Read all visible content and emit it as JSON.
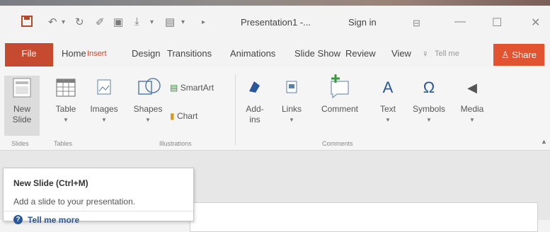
{
  "title_bar": {
    "document_title": "Presentation1 -...",
    "sign_in": "Sign in",
    "qat_icons": [
      "save-icon",
      "undo-icon",
      "redo-icon",
      "touch-mode-icon",
      "start-from-beginning-icon",
      "customize-qat-icon"
    ]
  },
  "tabs": [
    "File",
    "Home",
    "Insert",
    "Design",
    "Transitions",
    "Animations",
    "Slide Show",
    "Review",
    "View"
  ],
  "active_tab": "Insert",
  "tell_me": "Tell me",
  "share": "Share",
  "ribbon": {
    "new_slide": "New Slide",
    "table": "Table",
    "images": "Images",
    "shapes": "Shapes",
    "smartart": "SmartArt",
    "chart": "Chart",
    "addins": "Add-ins",
    "links": "Links",
    "comment": "Comment",
    "text": "Text",
    "symbols": "Symbols",
    "media": "Media",
    "groups": [
      "Slides",
      "Tables",
      "Illustrations",
      "Comments"
    ]
  },
  "tooltip": {
    "title": "New Slide (Ctrl+M)",
    "description": "Add a slide to your presentation.",
    "tell_me_more": "Tell me more"
  },
  "colors": {
    "accent": "#c64a2f",
    "share": "#e2532f",
    "link": "#2b579a"
  }
}
